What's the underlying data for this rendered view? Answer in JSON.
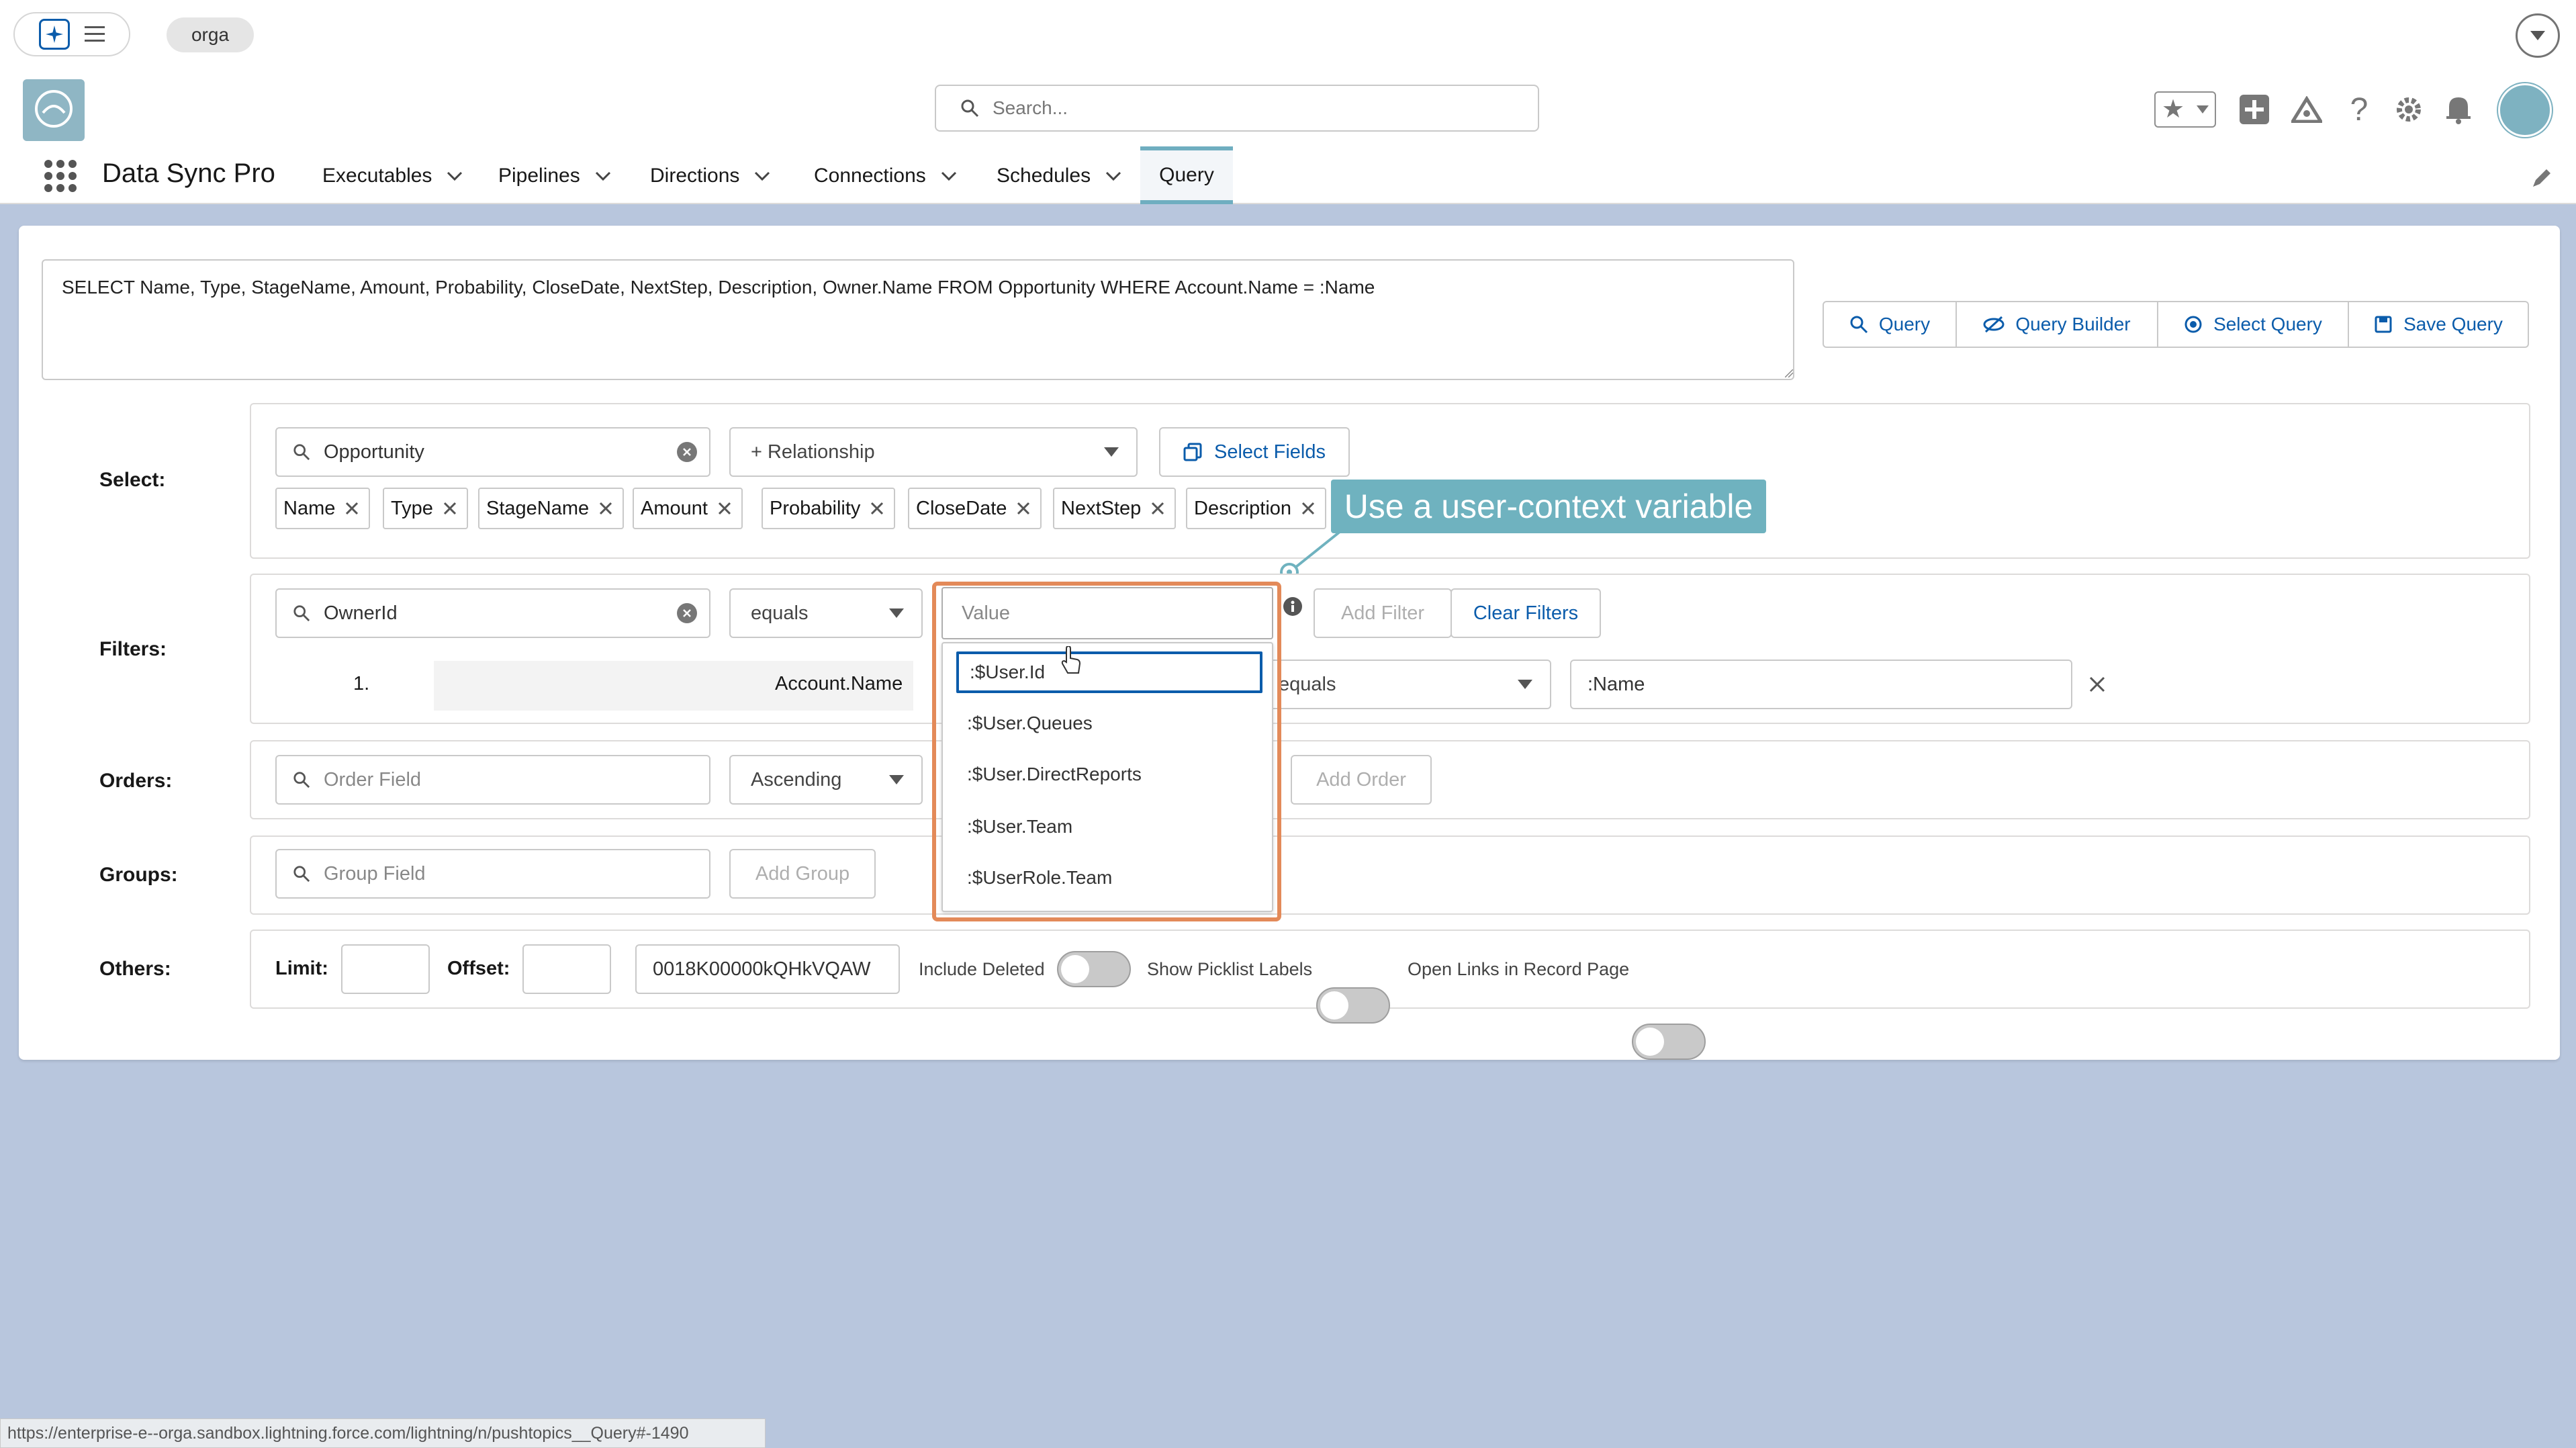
{
  "topbar": {
    "org": "orga"
  },
  "header": {
    "search_placeholder": "Search...",
    "app_name": "Data Sync Pro",
    "nav": [
      {
        "label": "Executables"
      },
      {
        "label": "Pipelines"
      },
      {
        "label": "Directions"
      },
      {
        "label": "Connections"
      },
      {
        "label": "Schedules"
      }
    ],
    "active_tab": "Query"
  },
  "query": {
    "soql": "SELECT Name, Type, StageName, Amount, Probability, CloseDate, NextStep, Description, Owner.Name FROM Opportunity WHERE Account.Name = :Name",
    "buttons": {
      "query": "Query",
      "builder": "Query Builder",
      "select": "Select Query",
      "save": "Save Query"
    }
  },
  "labels": {
    "select": "Select:",
    "filters": "Filters:",
    "orders": "Orders:",
    "groups": "Groups:",
    "others": "Others:"
  },
  "select": {
    "object": "Opportunity",
    "relationship_placeholder": "+ Relationship",
    "select_fields": "Select Fields",
    "chips": [
      "Name",
      "Type",
      "StageName",
      "Amount",
      "Probability",
      "CloseDate",
      "NextStep",
      "Description"
    ]
  },
  "callout": "Use a user-context variable",
  "filters": {
    "field": "OwnerId",
    "operator": "equals",
    "value_placeholder": "Value",
    "add_filter": "Add Filter",
    "clear_filters": "Clear Filters",
    "row_number": "1.",
    "row_field": "Account.Name",
    "row_operator": "equals",
    "row_value": ":Name",
    "options": [
      ":$User.Id",
      ":$User.Queues",
      ":$User.DirectReports",
      ":$User.Team",
      ":$UserRole.Team"
    ]
  },
  "orders": {
    "placeholder": "Order Field",
    "direction": "Ascending",
    "add_order": "Add Order"
  },
  "groups": {
    "placeholder": "Group Field",
    "add_group": "Add Group"
  },
  "others": {
    "limit_label": "Limit:",
    "offset_label": "Offset:",
    "record_id": "0018K00000kQHkVQAW",
    "include_deleted": "Include Deleted",
    "show_picklist": "Show Picklist Labels",
    "open_links": "Open Links in Record Page"
  },
  "status_url": "https://enterprise-e--orga.sandbox.lightning.force.com/lightning/n/pushtopics__Query#-1490"
}
